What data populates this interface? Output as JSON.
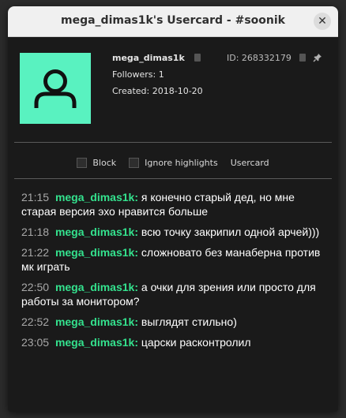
{
  "window": {
    "title": "mega_dimas1k's Usercard - #soonik",
    "close_glyph": "✕"
  },
  "user": {
    "username": "mega_dimas1k",
    "id_label": "ID: 268332179",
    "followers": "Followers: 1",
    "created": "Created: 2018-10-20",
    "avatar_color": "#59f2c0"
  },
  "options": {
    "block": "Block",
    "ignore_highlights": "Ignore highlights",
    "usercard": "Usercard"
  },
  "colors": {
    "author": "#34e28e",
    "timestamp": "#a8a8a8",
    "background": "#1a1a1a"
  },
  "messages": [
    {
      "time": "21:15",
      "author": "mega_dimas1k:",
      "text": "я конечно старый дед, но мне старая версия эхо нравится больше"
    },
    {
      "time": "21:18",
      "author": "mega_dimas1k:",
      "text": "всю точку закрипил одной арчей)))"
    },
    {
      "time": "21:22",
      "author": "mega_dimas1k:",
      "text": "сложновато без манаберна против мк играть"
    },
    {
      "time": "22:50",
      "author": "mega_dimas1k:",
      "text": "а очки для зрения или просто для работы за монитором?"
    },
    {
      "time": "22:52",
      "author": "mega_dimas1k:",
      "text": "выглядят стильно)"
    },
    {
      "time": "23:05",
      "author": "mega_dimas1k:",
      "text": "царски расконтролил"
    }
  ]
}
